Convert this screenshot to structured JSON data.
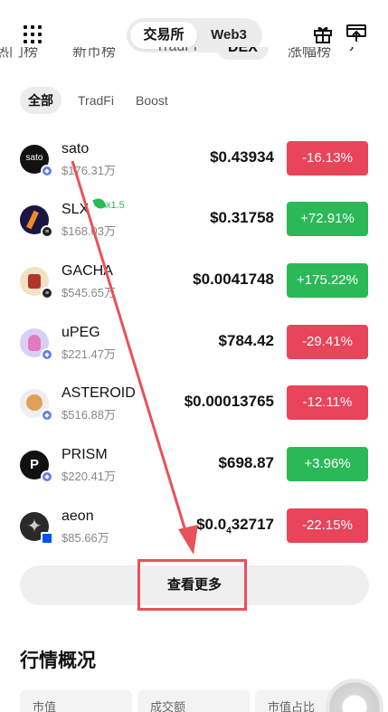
{
  "header": {
    "mode_active": "交易所",
    "mode_other": "Web3"
  },
  "category_tabs": [
    {
      "label": "热门榜"
    },
    {
      "label": "新币榜"
    },
    {
      "label": "TradFi"
    },
    {
      "label": "DEX"
    },
    {
      "label": "涨幅榜"
    }
  ],
  "sub_filters": [
    {
      "label": "全部"
    },
    {
      "label": "TradFi"
    },
    {
      "label": "Boost"
    }
  ],
  "rows": [
    {
      "name": "sato",
      "volume": "$176.31万",
      "price": "$0.43934",
      "change": "-16.13%",
      "dir": "down",
      "chain": "eth"
    },
    {
      "name": "SLX",
      "volume": "$168.03万",
      "price": "$0.31758",
      "change": "+72.91%",
      "dir": "up",
      "chain": "bsc",
      "boost": "x1.5"
    },
    {
      "name": "GACHA",
      "volume": "$545.65万",
      "price": "$0.0041748",
      "change": "+175.22%",
      "dir": "up",
      "chain": "bsc"
    },
    {
      "name": "uPEG",
      "volume": "$221.47万",
      "price": "$784.42",
      "change": "-29.41%",
      "dir": "down",
      "chain": "eth"
    },
    {
      "name": "ASTEROID",
      "volume": "$516.88万",
      "price": "$0.00013765",
      "change": "-12.11%",
      "dir": "down",
      "chain": "eth"
    },
    {
      "name": "PRISM",
      "volume": "$220.41万",
      "price": "$698.87",
      "change": "+3.96%",
      "dir": "up",
      "chain": "eth"
    },
    {
      "name": "aeon",
      "volume": "$85.66万",
      "price_main": "$0.0",
      "price_sub": "4",
      "price_rest": "32717",
      "change": "-22.15%",
      "dir": "down",
      "chain": "base"
    }
  ],
  "more_button": "查看更多",
  "overview": {
    "title": "行情概况",
    "tabs": [
      "市值",
      "成交额",
      "市值占比"
    ]
  },
  "colors": {
    "down": "#e8445a",
    "up": "#2bb957",
    "annotation": "#e8525a"
  }
}
